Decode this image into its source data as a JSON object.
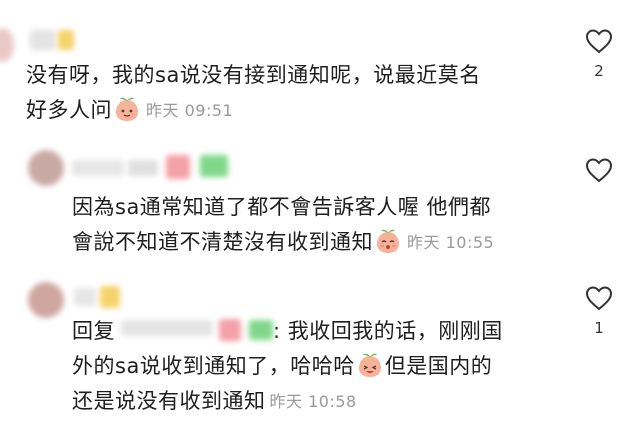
{
  "comments": [
    {
      "text_line1": "没有呀，我的sa说没有接到通知呢，说最近莫名",
      "text_line2": "好多人问",
      "time": "昨天 09:51",
      "likes": "2",
      "emoji": "peach-face-icon"
    },
    {
      "text_line1": "因為sa通常知道了都不會告訴客人喔 他們都",
      "text_line2": "會說不知道不清楚沒有收到通知",
      "time": "昨天 10:55",
      "likes": "",
      "emoji": "peach-cry-icon"
    },
    {
      "reply_prefix": "回复",
      "text_line1": ": 我收回我的话，刚刚国",
      "text_line2a": "外的sa说收到通知了，哈哈哈",
      "text_line2b": "但是国内的",
      "text_line3": "还是说没有收到通知",
      "time": "昨天 10:58",
      "likes": "1",
      "emoji": "peach-laugh-icon"
    }
  ],
  "colors": {
    "time": "#9a9a9a",
    "text": "#1e1e1e",
    "blur_green": "#7fd88a",
    "blur_pink": "#f3a0a6",
    "blur_yellow": "#f5d36a"
  }
}
